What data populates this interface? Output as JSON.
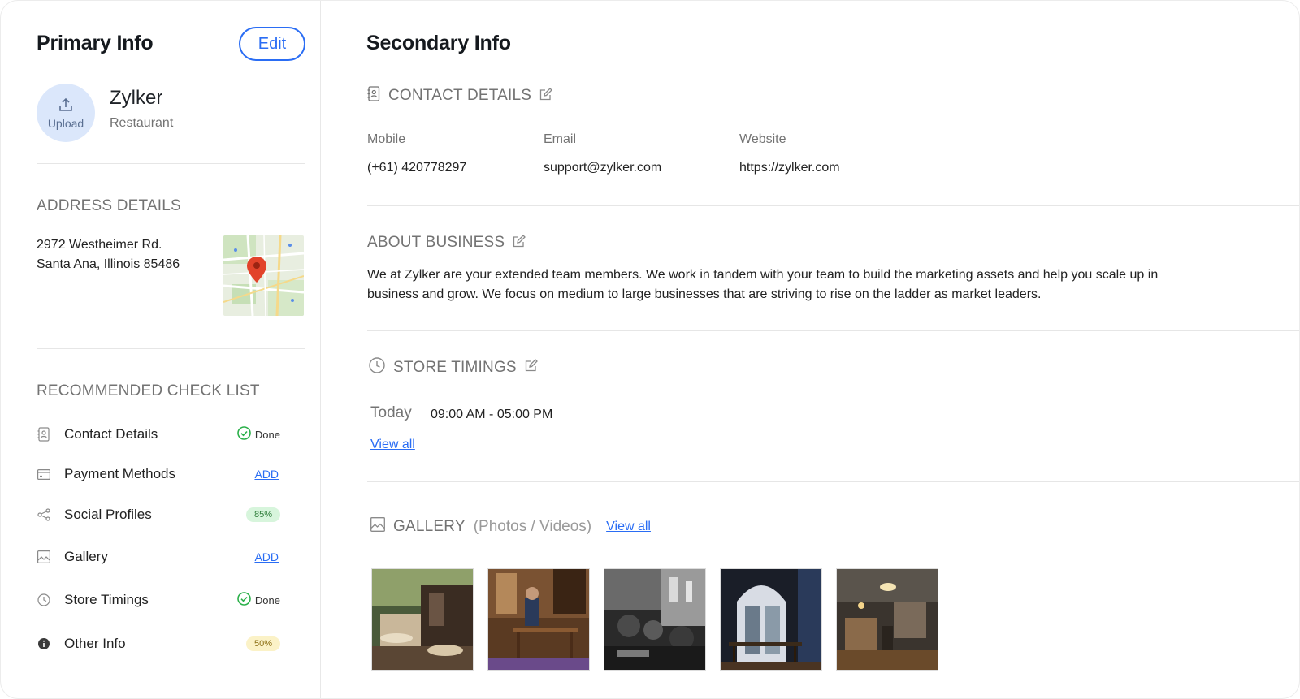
{
  "primary": {
    "title": "Primary Info",
    "edit_label": "Edit",
    "upload_label": "Upload",
    "business_name": "Zylker",
    "business_type": "Restaurant"
  },
  "address": {
    "heading": "ADDRESS DETAILS",
    "line1": "2972 Westheimer Rd.",
    "line2": "Santa Ana, Illinois 85486"
  },
  "checklist": {
    "heading": "RECOMMENDED CHECK LIST",
    "items": [
      {
        "label": "Contact Details",
        "status": "Done",
        "icon": "contact-book-icon"
      },
      {
        "label": "Payment Methods",
        "status": "ADD",
        "icon": "card-icon"
      },
      {
        "label": "Social Profiles",
        "status": "85%",
        "icon": "share-icon"
      },
      {
        "label": "Gallery",
        "status": "ADD",
        "icon": "image-icon"
      },
      {
        "label": "Store Timings",
        "status": "Done",
        "icon": "clock-icon"
      },
      {
        "label": "Other Info",
        "status": "50%",
        "icon": "info-icon"
      }
    ]
  },
  "secondary": {
    "title": "Secondary Info",
    "contact": {
      "heading": "CONTACT DETAILS",
      "mobile_label": "Mobile",
      "mobile": "(+61) 420778297",
      "email_label": "Email",
      "email": "support@zylker.com",
      "website_label": "Website",
      "website": "https://zylker.com"
    },
    "about": {
      "heading": "ABOUT BUSINESS",
      "line1": "We at Zylker are your extended team members. We work in tandem with your team to build the marketing assets and help you scale up in",
      "line2": "business and grow. We focus on medium to large businesses that are striving to rise on the ladder as market leaders."
    },
    "timings": {
      "heading": "STORE TIMINGS",
      "today_label": "Today",
      "today_hours": "09:00 AM - 05:00 PM",
      "view_all": "View all"
    },
    "gallery": {
      "heading": "GALLERY",
      "subheading": "(Photos / Videos)",
      "view_all": "View all"
    }
  },
  "colors": {
    "accent": "#2a6df4",
    "done_green": "#2bb04a",
    "pin_red": "#e2432a"
  }
}
